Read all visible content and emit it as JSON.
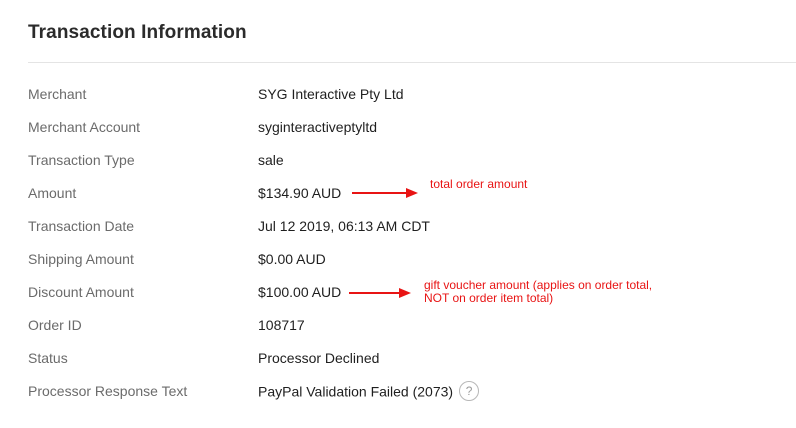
{
  "title": "Transaction Information",
  "rows": [
    {
      "label": "Merchant",
      "value": "SYG Interactive Pty Ltd"
    },
    {
      "label": "Merchant Account",
      "value": "syginteractiveptyltd"
    },
    {
      "label": "Transaction Type",
      "value": "sale"
    },
    {
      "label": "Amount",
      "value": "$134.90 AUD"
    },
    {
      "label": "Transaction Date",
      "value": "Jul 12 2019, 06:13 AM CDT"
    },
    {
      "label": "Shipping Amount",
      "value": "$0.00 AUD"
    },
    {
      "label": "Discount Amount",
      "value": "$100.00 AUD"
    },
    {
      "label": "Order ID",
      "value": "108717"
    },
    {
      "label": "Status",
      "value": "Processor Declined"
    },
    {
      "label": "Processor Response Text",
      "value": "PayPal Validation Failed (2073)"
    }
  ],
  "help_icon": "question-mark-icon",
  "annotations": {
    "amount_note": "total order amount",
    "discount_note_line1": "gift voucher amount (applies on order total,",
    "discount_note_line2": "NOT on order item total)",
    "color": "#e81414"
  }
}
